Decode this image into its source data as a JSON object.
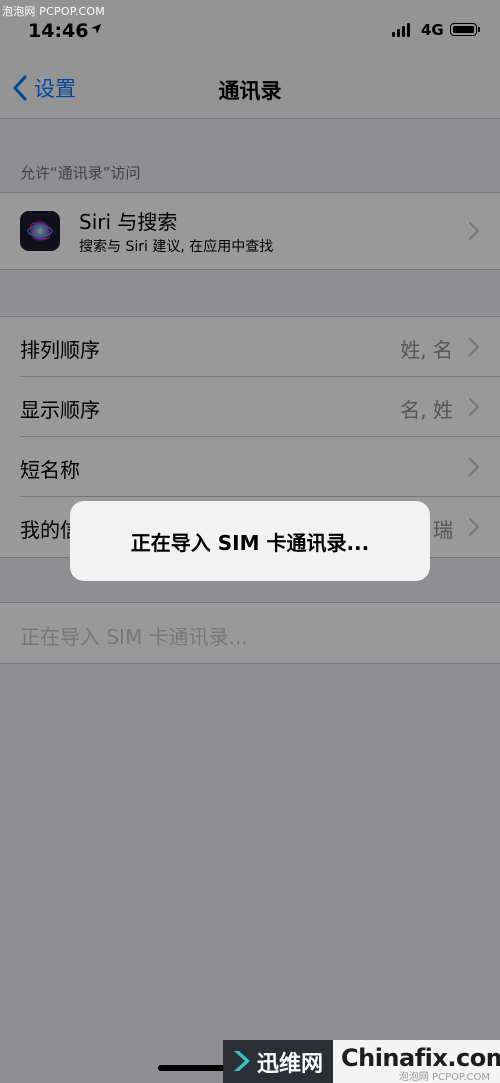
{
  "watermark_top": "泡泡网 PCPOP.COM",
  "status_bar": {
    "time": "14:46",
    "network": "4G"
  },
  "nav": {
    "back_label": "设置",
    "title": "通讯录"
  },
  "section_header": "允许“通讯录”访问",
  "siri": {
    "title": "Siri 与搜索",
    "subtitle": "搜索与 Siri 建议, 在应用中查找"
  },
  "rows": [
    {
      "label": "排列顺序",
      "value": "姓, 名"
    },
    {
      "label": "显示顺序",
      "value": "名, 姓"
    },
    {
      "label": "短名称",
      "value": ""
    },
    {
      "label": "我的信",
      "value": "瑞"
    }
  ],
  "import_row": "正在导入 SIM 卡通讯录...",
  "toast": "正在导入 SIM 卡通讯录...",
  "watermark_bottom": {
    "left": "迅维网",
    "right": "Chinafix.com",
    "small": "泡泡网 PCPOP.COM"
  },
  "colors": {
    "accent": "#007aff",
    "background": "#efeff4",
    "separator": "#c8c7cc"
  }
}
